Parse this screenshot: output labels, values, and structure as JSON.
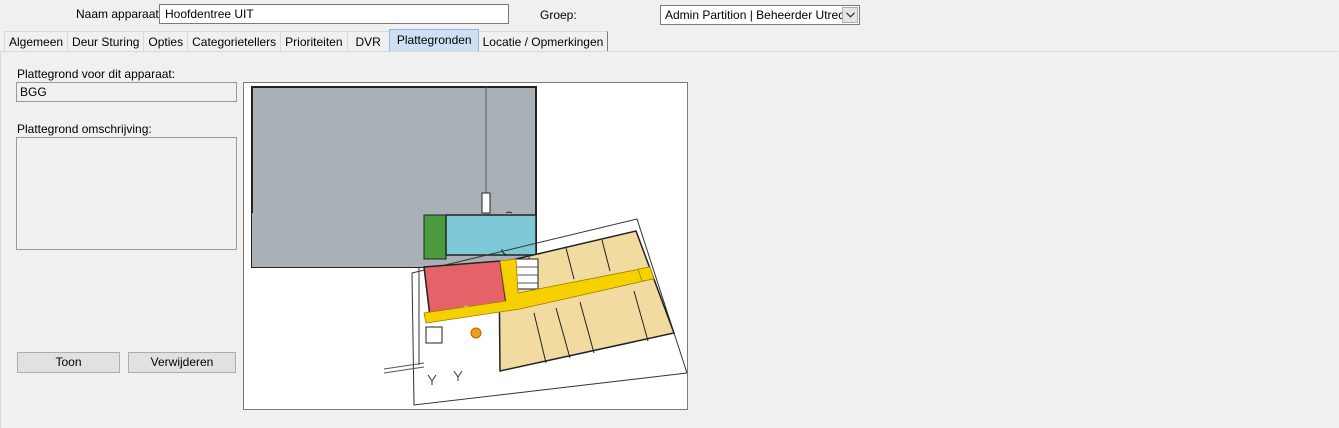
{
  "header": {
    "device_name_label": "Naam apparaat",
    "device_name_value": "Hoofdentree UIT",
    "group_label": "Groep:",
    "group_value": "Admin Partition | Beheerder Utrech"
  },
  "tabs": [
    {
      "label": "Algemeen"
    },
    {
      "label": "Deur Sturing"
    },
    {
      "label": "Opties"
    },
    {
      "label": "Categorietellers"
    },
    {
      "label": "Prioriteiten"
    },
    {
      "label": "DVR"
    },
    {
      "label": "Plattegronden"
    },
    {
      "label": "Locatie / Opmerkingen"
    }
  ],
  "active_tab": "Plattegronden",
  "floorplan": {
    "plan_label": "Plattegrond voor dit apparaat:",
    "plan_value": "BGG",
    "description_label": "Plattegrond omschrijving:",
    "description_value": "",
    "show_button": "Toon",
    "remove_button": "Verwijderen",
    "image_icon": "floorplan-image",
    "colors": {
      "gray_hall": "#a9b0b6",
      "cyan_room": "#7ec8d8",
      "green_room": "#4c9a3e",
      "red_room": "#e56368",
      "yellow_corridor": "#f7d000",
      "tan_rooms": "#f1dba0"
    }
  }
}
